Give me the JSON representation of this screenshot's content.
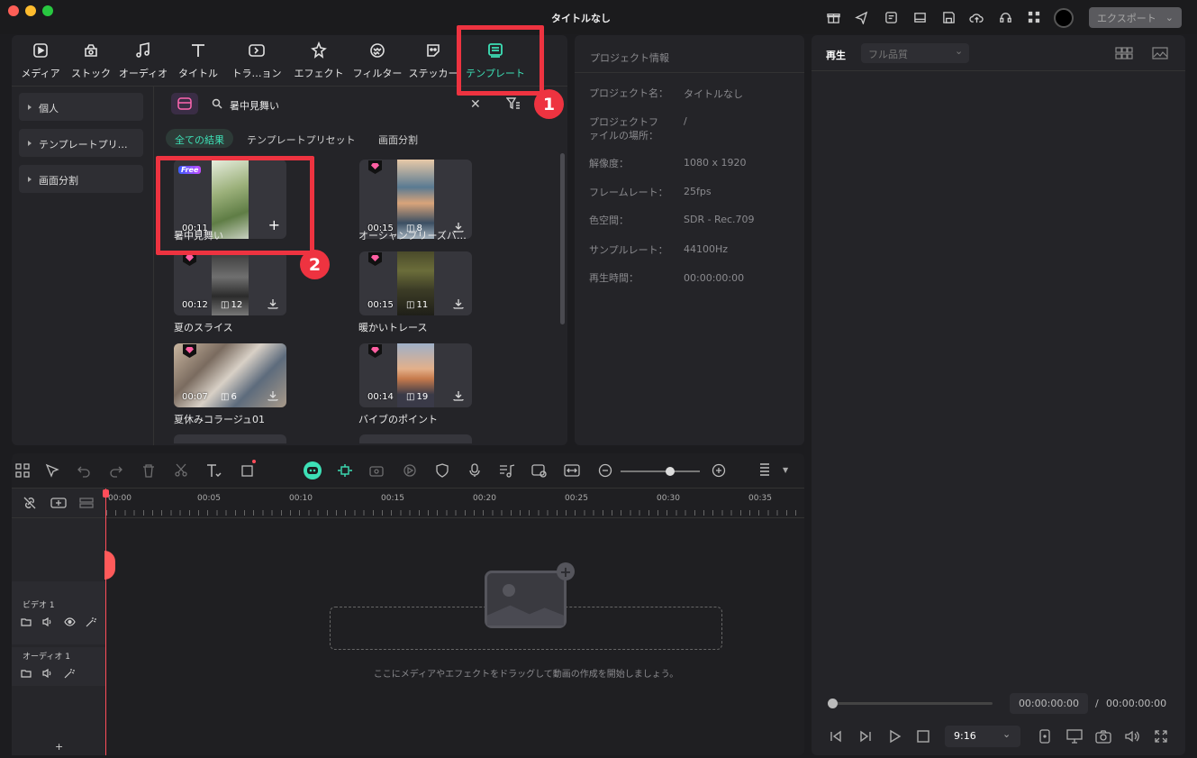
{
  "window": {
    "title": "タイトルなし",
    "export_label": "エクスポート"
  },
  "nav": {
    "items": [
      {
        "label": "メディア",
        "icon": "media-icon"
      },
      {
        "label": "ストック",
        "icon": "stock-icon"
      },
      {
        "label": "オーディオ",
        "icon": "audio-icon"
      },
      {
        "label": "タイトル",
        "icon": "title-icon"
      },
      {
        "label": "トラ…ョン",
        "icon": "transition-icon"
      },
      {
        "label": "エフェクト",
        "icon": "effect-icon"
      },
      {
        "label": "フィルター",
        "icon": "filter-icon"
      },
      {
        "label": "ステッカー",
        "icon": "sticker-icon"
      },
      {
        "label": "テンプレート",
        "icon": "template-icon",
        "active": true
      }
    ]
  },
  "sidebar": {
    "folders": [
      "個人",
      "テンプレートプリ…",
      "画面分割"
    ]
  },
  "search": {
    "value": "暑中見舞い"
  },
  "filter_chips": [
    "全ての結果",
    "テンプレートプリセット",
    "画面分割"
  ],
  "templates": [
    {
      "title": "暑中見舞い",
      "duration": "00:11",
      "count": "",
      "badge": "Free"
    },
    {
      "title": "オーシャンブリーズバ…",
      "duration": "00:15",
      "count": "8",
      "badge": "premium"
    },
    {
      "title": "夏のスライス",
      "duration": "00:12",
      "count": "12",
      "badge": "premium"
    },
    {
      "title": "暖かいトレース",
      "duration": "00:15",
      "count": "11",
      "badge": "premium"
    },
    {
      "title": "夏休みコラージュ01",
      "duration": "00:07",
      "count": "6",
      "badge": "premium"
    },
    {
      "title": "バイブのポイント",
      "duration": "00:14",
      "count": "19",
      "badge": "premium"
    }
  ],
  "project_info": {
    "header": "プロジェクト情報",
    "rows": [
      {
        "label": "プロジェクト名：",
        "value": "タイトルなし"
      },
      {
        "label": "プロジェクトファイルの場所：",
        "value": "/"
      },
      {
        "label": "解像度：",
        "value": "1080 x 1920"
      },
      {
        "label": "フレームレート：",
        "value": "25fps"
      },
      {
        "label": "色空間：",
        "value": "SDR - Rec.709"
      },
      {
        "label": "サンプルレート：",
        "value": "44100Hz"
      },
      {
        "label": "再生時間：",
        "value": "00:00:00:00"
      }
    ]
  },
  "preview": {
    "tab": "再生",
    "quality": "フル品質",
    "current_time": "00:00:00:00",
    "separator": "/",
    "total_time": "00:00:00:00",
    "aspect": "9:16"
  },
  "timeline": {
    "ruler": [
      "00:00",
      "00:05",
      "00:10",
      "00:15",
      "00:20",
      "00:25",
      "00:30",
      "00:35"
    ],
    "tracks": [
      {
        "name": "ビデオ 1"
      },
      {
        "name": "オーディオ 1"
      }
    ],
    "drop_hint": "ここにメディアやエフェクトをドラッグして動画の作成を開始しましょう。",
    "add_track": "+"
  },
  "annotations": {
    "badge1": "1",
    "badge2": "2"
  },
  "colors": {
    "accent": "#3de0b6",
    "annotation_red": "#ee3340",
    "playhead": "#ff4d5a"
  }
}
